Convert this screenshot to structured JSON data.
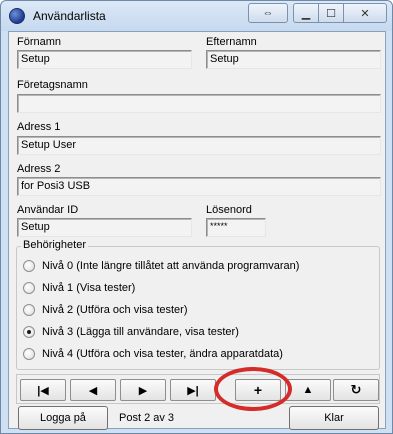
{
  "window": {
    "title": "Användarlista"
  },
  "form": {
    "fornamn_label": "Förnamn",
    "fornamn_value": "Setup",
    "efternamn_label": "Efternamn",
    "efternamn_value": "Setup",
    "foretag_label": "Företagsnamn",
    "foretag_value": "",
    "adress1_label": "Adress 1",
    "adress1_value": "Setup User",
    "adress2_label": "Adress 2",
    "adress2_value": "for Posi3 USB",
    "anvandarid_label": "Användar ID",
    "anvandarid_value": "Setup",
    "losenord_label": "Lösenord",
    "losenord_value": "*****"
  },
  "permissions": {
    "title": "Behörigheter",
    "selected_index": 3,
    "options": [
      "Nivå 0 (Inte längre tillåtet att använda programvaran)",
      "Nivå 1 (Visa tester)",
      "Nivå 2 (Utföra och visa tester)",
      "Nivå 3 (Lägga till användare, visa tester)",
      "Nivå 4 (Utföra och visa tester, ändra apparatdata)"
    ]
  },
  "navigator": {
    "first": "|◀",
    "prev": "◀",
    "next": "▶",
    "last": "▶|",
    "add": "+",
    "up": "▲",
    "refresh": "↻"
  },
  "footer": {
    "login_label": "Logga på",
    "record_status": "Post 2 av 3",
    "done_label": "Klar"
  },
  "annotation": {
    "color": "#d42b2b"
  }
}
